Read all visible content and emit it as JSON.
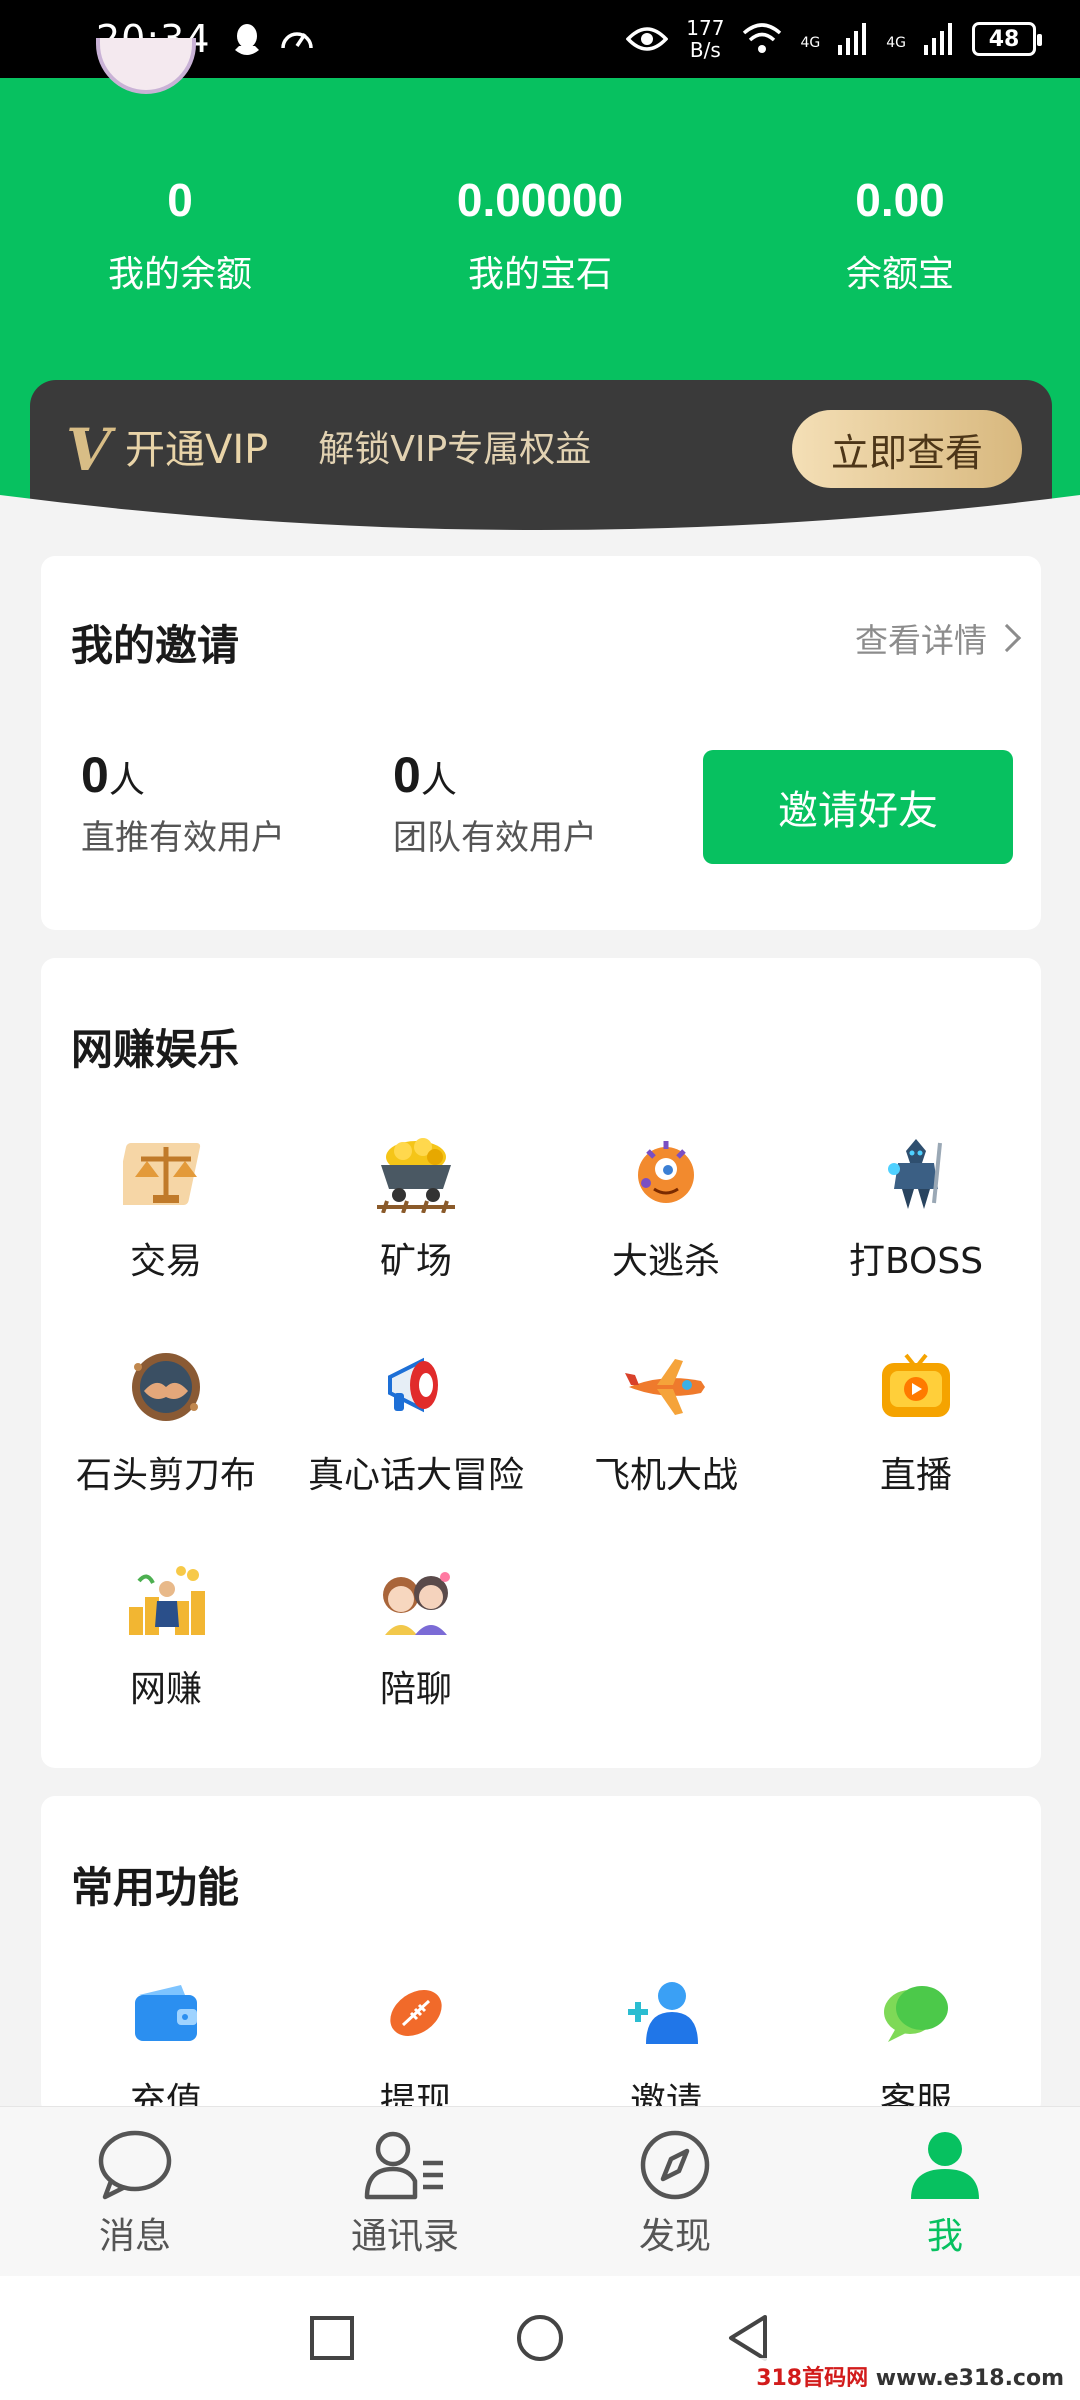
{
  "status_bar": {
    "time": "20:34",
    "speed_value": "177",
    "speed_unit": "B/s",
    "network_1": "4G",
    "network_2": "4G",
    "battery": "48"
  },
  "header": {
    "stats": [
      {
        "value": "0",
        "label": "我的余额"
      },
      {
        "value": "0.00000",
        "label": "我的宝石"
      },
      {
        "value": "0.00",
        "label": "余额宝"
      }
    ]
  },
  "vip": {
    "logo": "V",
    "title": "开通VIP",
    "subtitle": "解锁VIP专属权益",
    "button": "立即查看"
  },
  "invite": {
    "title": "我的邀请",
    "detail_link": "查看详情",
    "direct_count": "0",
    "direct_unit": "人",
    "direct_label": "直推有效用户",
    "team_count": "0",
    "team_unit": "人",
    "team_label": "团队有效用户",
    "button": "邀请好友"
  },
  "entertainment": {
    "title": "网赚娱乐",
    "items": [
      {
        "label": "交易",
        "icon": "scale-icon"
      },
      {
        "label": "矿场",
        "icon": "mine-cart-icon"
      },
      {
        "label": "大逃杀",
        "icon": "monster-icon"
      },
      {
        "label": "打BOSS",
        "icon": "boss-icon"
      },
      {
        "label": "石头剪刀布",
        "icon": "handshake-icon"
      },
      {
        "label": "真心话大冒险",
        "icon": "megaphone-icon"
      },
      {
        "label": "飞机大战",
        "icon": "plane-icon"
      },
      {
        "label": "直播",
        "icon": "live-tv-icon"
      },
      {
        "label": "网赚",
        "icon": "money-icon"
      },
      {
        "label": "陪聊",
        "icon": "chat-people-icon"
      }
    ]
  },
  "common": {
    "title": "常用功能",
    "items": [
      {
        "label": "充值",
        "icon": "wallet-icon"
      },
      {
        "label": "提现",
        "icon": "football-icon"
      },
      {
        "label": "邀请",
        "icon": "add-user-icon"
      },
      {
        "label": "客服",
        "icon": "chat-bubble-icon"
      }
    ]
  },
  "bottom_nav": {
    "items": [
      {
        "label": "消息",
        "icon": "message-icon",
        "active": false
      },
      {
        "label": "通讯录",
        "icon": "contacts-icon",
        "active": false
      },
      {
        "label": "发现",
        "icon": "compass-icon",
        "active": false
      },
      {
        "label": "我",
        "icon": "profile-icon",
        "active": true
      }
    ]
  },
  "watermark": {
    "brand": "318首码网",
    "url": "www.e318.com"
  },
  "colors": {
    "brand_green": "#07c160",
    "vip_dark": "#3a3a3a",
    "vip_gold": "#d8bd86"
  }
}
